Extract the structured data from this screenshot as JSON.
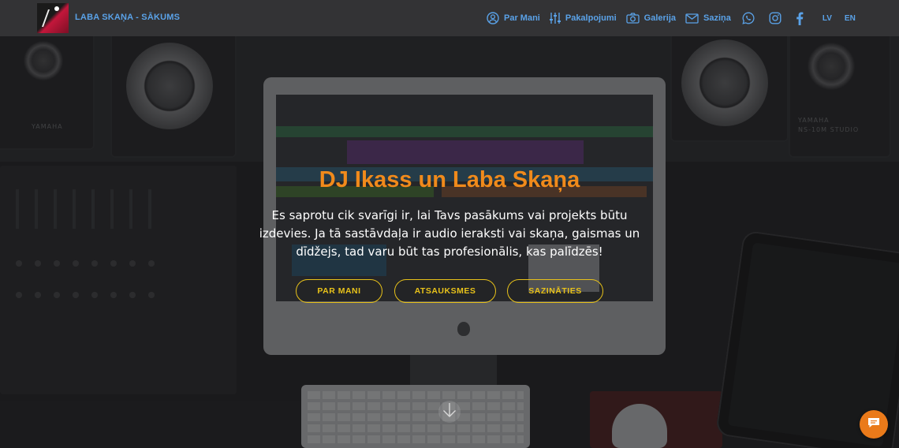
{
  "header": {
    "brand_title": "LABA SKAŅA - SĀKUMS",
    "nav": [
      {
        "label": "Par Mani",
        "icon": "user-circle-icon"
      },
      {
        "label": "Pakalpojumi",
        "icon": "equalizer-icon"
      },
      {
        "label": "Galerija",
        "icon": "camera-icon"
      },
      {
        "label": "Saziņa",
        "icon": "envelope-icon"
      }
    ],
    "social": [
      "whatsapp-icon",
      "instagram-icon",
      "facebook-icon"
    ],
    "languages": [
      "LV",
      "EN"
    ]
  },
  "hero": {
    "title": "DJ Ikass un Laba Skaņa",
    "text": "Es saprotu cik svarīgi ir, lai Tavs pasākums vai projekts būtu izdevies. Ja tā sastāvdaļa ir audio ieraksti vai skaņa, gaismas un dīdžejs, tad varu būt tas profesionālis, kas palīdzēs!",
    "buttons": [
      "PAR MANI",
      "ATSAUKSMES",
      "SAZINĀTIES"
    ]
  },
  "colors": {
    "nav_text": "#5aa2e8",
    "title": "#f08a1b",
    "button": "#e8c21a",
    "chat": "#ea7a1a",
    "navbar_bg": "#333335"
  },
  "icons": {
    "scroll": "arrow-down-icon",
    "chat": "chat-bubble-icon"
  }
}
